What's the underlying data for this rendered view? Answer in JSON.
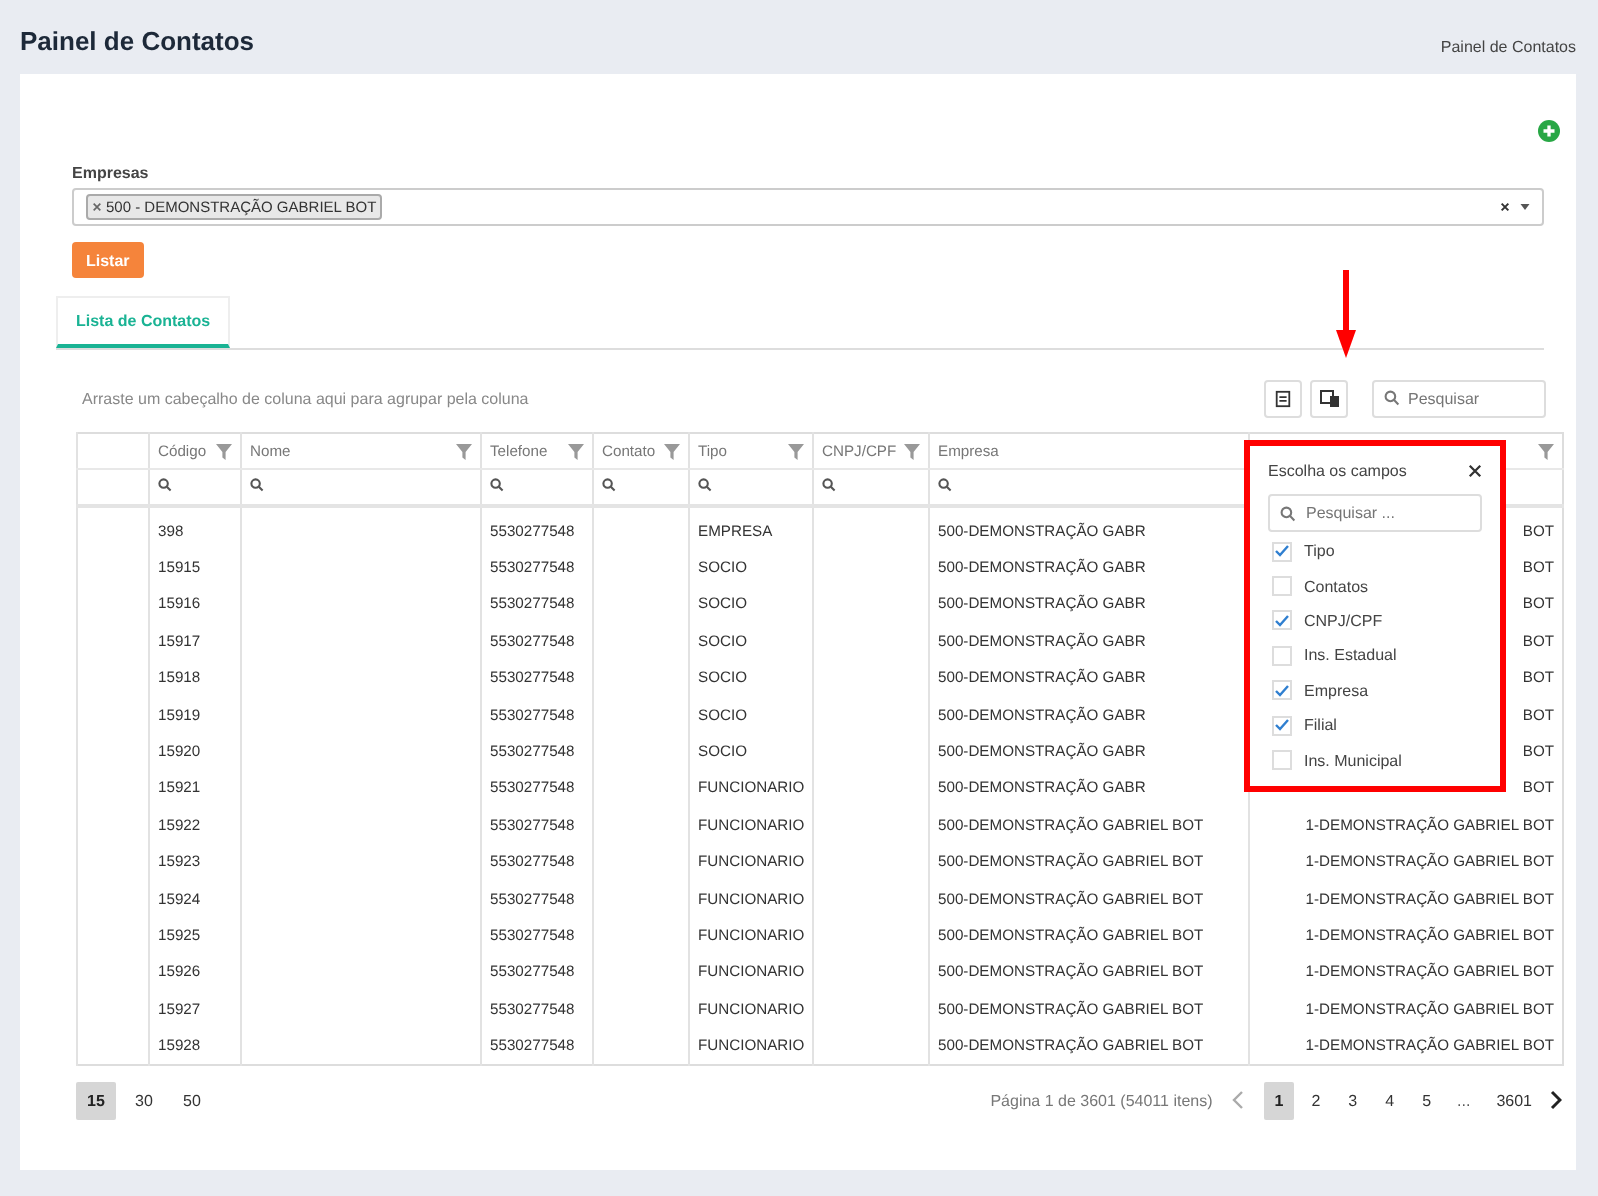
{
  "header": {
    "title": "Painel de Contatos",
    "breadcrumb": "Painel de Contatos"
  },
  "form": {
    "label": "Empresas",
    "tags": [
      {
        "text": "500 - DEMONSTRAÇÃO GABRIEL BOT"
      }
    ],
    "button": "Listar"
  },
  "tabs": [
    {
      "label": "Lista de Contatos",
      "selected": true
    }
  ],
  "grid": {
    "group_hint": "Arraste um cabeçalho de coluna aqui para agrupar pela coluna",
    "search_placeholder": "Pesquisar",
    "columns": [
      {
        "filter": false,
        "search": false
      },
      {
        "label": "Código",
        "filter": true,
        "search": true
      },
      {
        "label": "Nome",
        "filter": true,
        "search": true
      },
      {
        "label": "Telefone",
        "filter": true,
        "search": true
      },
      {
        "label": "Contato",
        "filter": true,
        "search": true
      },
      {
        "label": "Tipo",
        "filter": true,
        "search": true
      },
      {
        "label": "CNPJ/CPF",
        "filter": true,
        "search": true
      },
      {
        "label": "Empresa",
        "filter": false,
        "search": true
      },
      {
        "filter": true,
        "search": false
      }
    ],
    "rows": [
      {
        "codigo": "398",
        "telefone": "5530277548",
        "tipo": "EMPRESA",
        "empresa": "500-DEMONSTRAÇÃO GABR",
        "column_9": "BOT"
      },
      {
        "codigo": "15915",
        "telefone": "5530277548",
        "tipo": "SOCIO",
        "empresa": "500-DEMONSTRAÇÃO GABR",
        "column_9": "BOT"
      },
      {
        "codigo": "15916",
        "telefone": "5530277548",
        "tipo": "SOCIO",
        "empresa": "500-DEMONSTRAÇÃO GABR",
        "column_9": "BOT"
      },
      {
        "codigo": "15917",
        "telefone": "5530277548",
        "tipo": "SOCIO",
        "empresa": "500-DEMONSTRAÇÃO GABR",
        "column_9": "BOT"
      },
      {
        "codigo": "15918",
        "telefone": "5530277548",
        "tipo": "SOCIO",
        "empresa": "500-DEMONSTRAÇÃO GABR",
        "column_9": "BOT"
      },
      {
        "codigo": "15919",
        "telefone": "5530277548",
        "tipo": "SOCIO",
        "empresa": "500-DEMONSTRAÇÃO GABR",
        "column_9": "BOT"
      },
      {
        "codigo": "15920",
        "telefone": "5530277548",
        "tipo": "SOCIO",
        "empresa": "500-DEMONSTRAÇÃO GABR",
        "column_9": "BOT"
      },
      {
        "codigo": "15921",
        "telefone": "5530277548",
        "tipo": "FUNCIONARIO",
        "empresa": "500-DEMONSTRAÇÃO GABR",
        "column_9": "BOT"
      },
      {
        "codigo": "15922",
        "telefone": "5530277548",
        "tipo": "FUNCIONARIO",
        "empresa": "500-DEMONSTRAÇÃO GABRIEL BOT",
        "column_9": "1-DEMONSTRAÇÃO GABRIEL BOT"
      },
      {
        "codigo": "15923",
        "telefone": "5530277548",
        "tipo": "FUNCIONARIO",
        "empresa": "500-DEMONSTRAÇÃO GABRIEL BOT",
        "column_9": "1-DEMONSTRAÇÃO GABRIEL BOT"
      },
      {
        "codigo": "15924",
        "telefone": "5530277548",
        "tipo": "FUNCIONARIO",
        "empresa": "500-DEMONSTRAÇÃO GABRIEL BOT",
        "column_9": "1-DEMONSTRAÇÃO GABRIEL BOT"
      },
      {
        "codigo": "15925",
        "telefone": "5530277548",
        "tipo": "FUNCIONARIO",
        "empresa": "500-DEMONSTRAÇÃO GABRIEL BOT",
        "column_9": "1-DEMONSTRAÇÃO GABRIEL BOT"
      },
      {
        "codigo": "15926",
        "telefone": "5530277548",
        "tipo": "FUNCIONARIO",
        "empresa": "500-DEMONSTRAÇÃO GABRIEL BOT",
        "column_9": "1-DEMONSTRAÇÃO GABRIEL BOT"
      },
      {
        "codigo": "15927",
        "telefone": "5530277548",
        "tipo": "FUNCIONARIO",
        "empresa": "500-DEMONSTRAÇÃO GABRIEL BOT",
        "column_9": "1-DEMONSTRAÇÃO GABRIEL BOT"
      },
      {
        "codigo": "15928",
        "telefone": "5530277548",
        "tipo": "FUNCIONARIO",
        "empresa": "500-DEMONSTRAÇÃO GABRIEL BOT",
        "column_9": "1-DEMONSTRAÇÃO GABRIEL BOT"
      }
    ],
    "page_sizes": [
      {
        "label": "15",
        "selected": true
      },
      {
        "label": "30",
        "selected": false
      },
      {
        "label": "50",
        "selected": false
      }
    ],
    "page_info": "Página 1 de 3601 (54011 itens)",
    "pages": [
      {
        "label": "1",
        "selected": true
      },
      {
        "label": "2",
        "selected": false
      },
      {
        "label": "3",
        "selected": false
      },
      {
        "label": "4",
        "selected": false
      },
      {
        "label": "5",
        "selected": false
      },
      {
        "label": "...",
        "kind": "ellipsis"
      },
      {
        "label": "3601",
        "selected": false
      }
    ]
  },
  "column_chooser": {
    "title": "Escolha os campos",
    "search_placeholder": "Pesquisar ...",
    "fields": [
      {
        "label": "Tipo",
        "checked": true
      },
      {
        "label": "Contatos",
        "checked": false
      },
      {
        "label": "CNPJ/CPF",
        "checked": true
      },
      {
        "label": "Ins. Estadual",
        "checked": false
      },
      {
        "label": "Empresa",
        "checked": true
      },
      {
        "label": "Filial",
        "checked": true
      },
      {
        "label": "Ins. Municipal",
        "checked": false
      }
    ]
  }
}
